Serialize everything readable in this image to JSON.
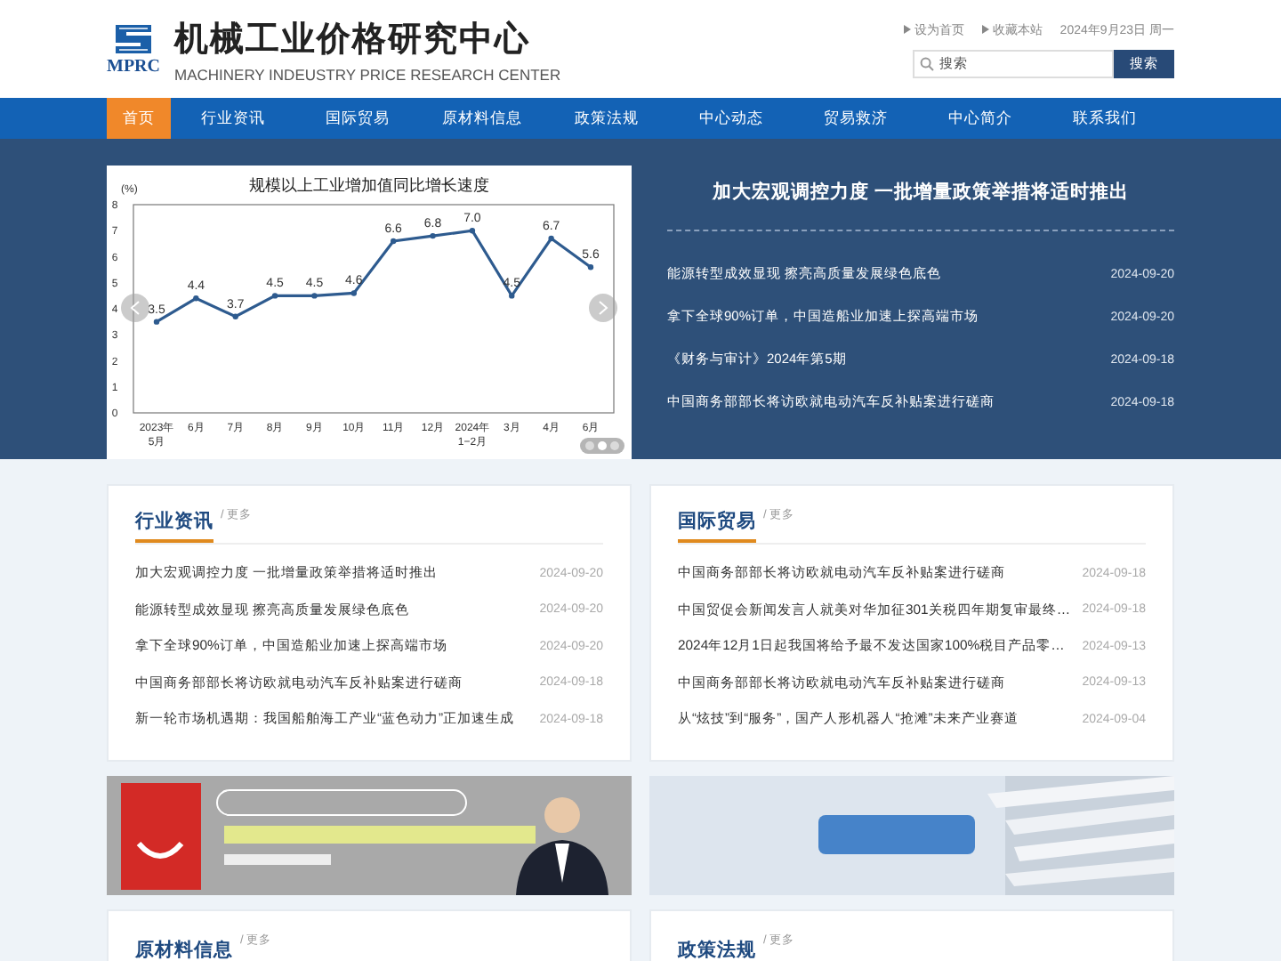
{
  "header": {
    "logo_text": "MPRC",
    "title": "机械工业价格研究中心",
    "subtitle": "MACHINERY INDEUSTRY PRICE RESEARCH CENTER",
    "links": [
      "设为首页",
      "收藏本站"
    ],
    "date": "2024年9月23日 周一",
    "search": {
      "placeholder": "搜索"
    },
    "search_button": "搜索"
  },
  "nav": [
    {
      "label": "首页",
      "selected": true
    },
    {
      "label": "行业资讯",
      "selected": false
    },
    {
      "label": "国际贸易",
      "selected": false
    },
    {
      "label": "原材料信息",
      "selected": false
    },
    {
      "label": "政策法规",
      "selected": false
    },
    {
      "label": "中心动态",
      "selected": false
    },
    {
      "label": "贸易救济",
      "selected": false
    },
    {
      "label": "中心简介",
      "selected": false
    },
    {
      "label": "联系我们",
      "selected": false
    }
  ],
  "hero": {
    "slide": {
      "chart_data": {
        "type": "line",
        "title": "规模以上工业增加值同比增长速度",
        "ylabel": "(%)",
        "categories": [
          "2023年\n5月",
          "6月",
          "7月",
          "8月",
          "9月",
          "10月",
          "11月",
          "12月",
          "2024年\n1−2月",
          "3月",
          "4月",
          "6月"
        ],
        "series": [
          {
            "color": "#2e5b8f",
            "marker": true,
            "values": [
              3.5,
              4.4,
              3.7,
              4.5,
              4.5,
              4.6,
              6.6,
              6.8,
              7.0,
              4.5,
              6.7,
              5.6
            ]
          }
        ],
        "ylim": [
          0,
          8
        ],
        "yticks": [
          0,
          1,
          2,
          3,
          4,
          5,
          6,
          7,
          8
        ],
        "value_labels": [
          "3.5",
          "4.4",
          "3.7",
          "4.5",
          "4.5",
          "4.6",
          "6.6",
          "6.8",
          "7.0",
          "4.5",
          "6.7",
          "5.6"
        ]
      },
      "dots": [
        {
          "selected": false
        },
        {
          "selected": true
        },
        {
          "selected": false
        }
      ]
    },
    "headline": "加大宏观调控力度 一批增量政策举措将适时推出",
    "news": [
      {
        "title": "能源转型成效显现 擦亮高质量发展绿色底色",
        "date": "2024-09-20"
      },
      {
        "title": "拿下全球90%订单，中国造船业加速上探高端市场",
        "date": "2024-09-20"
      },
      {
        "title": "《财务与审计》2024年第5期",
        "date": "2024-09-18"
      },
      {
        "title": "中国商务部部长将访欧就电动汽车反补贴案进行磋商",
        "date": "2024-09-18"
      }
    ]
  },
  "sections_top": [
    {
      "title": "行业资讯",
      "more": "/ 更多",
      "items": [
        {
          "title": "加大宏观调控力度 一批增量政策举措将适时推出",
          "date": "2024-09-20"
        },
        {
          "title": "能源转型成效显现 擦亮高质量发展绿色底色",
          "date": "2024-09-20"
        },
        {
          "title": "拿下全球90%订单，中国造船业加速上探高端市场",
          "date": "2024-09-20"
        },
        {
          "title": "中国商务部部长将访欧就电动汽车反补贴案进行磋商",
          "date": "2024-09-18"
        },
        {
          "title": "新一轮市场机遇期：我国船舶海工产业“蓝色动力”正加速生成",
          "date": "2024-09-18"
        }
      ]
    },
    {
      "title": "国际贸易",
      "more": "/ 更多",
      "items": [
        {
          "title": "中国商务部部长将访欧就电动汽车反补贴案进行磋商",
          "date": "2024-09-18"
        },
        {
          "title": "中国贸促会新闻发言人就美对华加征301关税四年期复审最终…",
          "date": "2024-09-18"
        },
        {
          "title": "2024年12月1日起我国将给予最不发达国家100%税目产品零…",
          "date": "2024-09-13"
        },
        {
          "title": "中国商务部部长将访欧就电动汽车反补贴案进行磋商",
          "date": "2024-09-13"
        },
        {
          "title": "从“炫技”到“服务”，国产人形机器人“抢滩”未来产业赛道",
          "date": "2024-09-04"
        }
      ]
    }
  ],
  "sections_bottom": [
    {
      "title": "原材料信息",
      "more": "/ 更多"
    },
    {
      "title": "政策法规",
      "more": "/ 更多"
    }
  ]
}
